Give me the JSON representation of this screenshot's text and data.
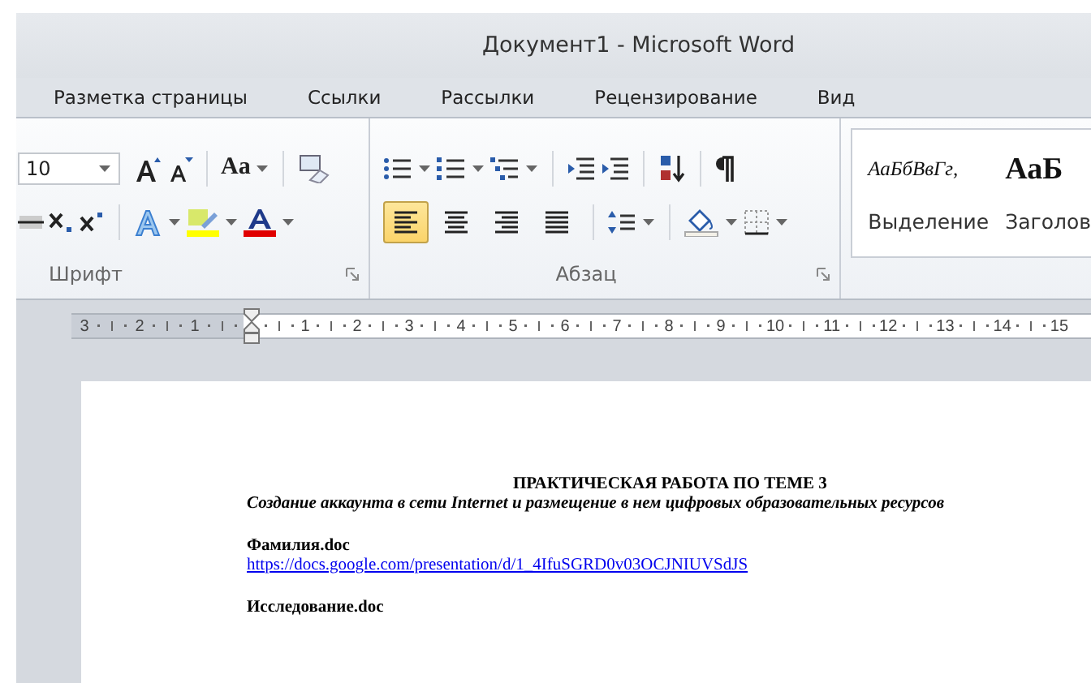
{
  "window": {
    "title": "Документ1  -  Microsoft Word"
  },
  "tabs": [
    {
      "label": "Разметка страницы",
      "selected": false
    },
    {
      "label": "Ссылки",
      "selected": false
    },
    {
      "label": "Рассылки",
      "selected": false
    },
    {
      "label": "Рецензирование",
      "selected": false
    },
    {
      "label": "Вид",
      "selected": false
    }
  ],
  "font_group": {
    "label": "Шрифт",
    "font_size": "10",
    "case_glyph": "Aa"
  },
  "paragraph_group": {
    "label": "Абзац",
    "align_buttons": [
      {
        "kind": "left",
        "selected": true
      },
      {
        "kind": "center",
        "selected": false
      },
      {
        "kind": "right",
        "selected": false
      },
      {
        "kind": "justify",
        "selected": false
      }
    ]
  },
  "styles_gallery": [
    {
      "kind": "emphasis",
      "sample": "АаБбВвГг,",
      "name": "Выделение"
    },
    {
      "kind": "heading",
      "sample": "АаБ",
      "name": "Заголов"
    }
  ],
  "ruler": {
    "left_numbers": [
      "3",
      "2",
      "1"
    ],
    "right_numbers": [
      "1",
      "2",
      "3",
      "4",
      "5",
      "6",
      "7",
      "8",
      "9",
      "10",
      "11",
      "12",
      "13",
      "14",
      "15"
    ]
  },
  "document": {
    "lines": [
      {
        "kind": "title",
        "text": "ПРАКТИЧЕСКАЯ РАБОТА ПО ТЕМЕ 3"
      },
      {
        "kind": "subtitle",
        "text": "Создание аккаунта в сети Internet и размещение в нем цифровых образовательных ресурсов"
      },
      {
        "kind": "gap"
      },
      {
        "kind": "bold",
        "text": "Фамилия.doc"
      },
      {
        "kind": "link",
        "text": "https://docs.google.com/presentation/d/1_4IfuSGRD0v03OCJNIUVSdJS"
      },
      {
        "kind": "gap"
      },
      {
        "kind": "bold",
        "text": "Исследование.doc"
      }
    ]
  }
}
